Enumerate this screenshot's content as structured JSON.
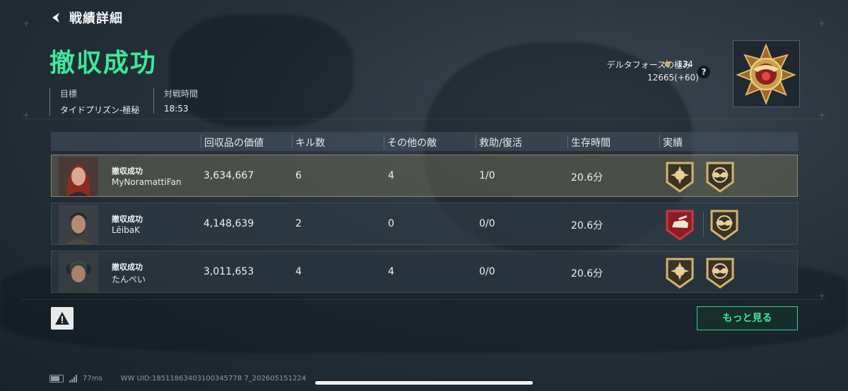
{
  "header": {
    "title": "戦績詳細"
  },
  "result": {
    "title": "撤収成功"
  },
  "info": {
    "target_label": "目標",
    "target_value": "タイドプリズン-極秘",
    "time_label": "対戦時間",
    "time_value": "18:53"
  },
  "rank": {
    "name": "デルタフォースの極み",
    "level": "134",
    "points": "12665(+60)",
    "help": "?"
  },
  "table": {
    "headers": [
      "回収品の価値",
      "キル数",
      "その他の敵",
      "救助/復活",
      "生存時間",
      "実績"
    ],
    "rows": [
      {
        "status": "撤収成功",
        "name": "MyNoramattiFan",
        "value": "3,634,667",
        "kills": "6",
        "other": "4",
        "rescue": "1/0",
        "survival": "20.6分",
        "highlight": true,
        "achievements": [
          "gold-sun-emblem",
          "gold-wings-emblem"
        ]
      },
      {
        "status": "撤収成功",
        "name": "LëibaK",
        "value": "4,148,639",
        "kills": "2",
        "other": "0",
        "rescue": "0/0",
        "survival": "20.6分",
        "highlight": false,
        "achievements": [
          "red-tank-emblem",
          "gold-wings-emblem"
        ]
      },
      {
        "status": "撤収成功",
        "name": "たんぺい",
        "value": "3,011,653",
        "kills": "4",
        "other": "4",
        "rescue": "0/0",
        "survival": "20.6分",
        "highlight": false,
        "achievements": [
          "gold-sun-emblem",
          "gold-wings-emblem"
        ]
      }
    ]
  },
  "buttons": {
    "more": "もっと見る"
  },
  "footer": {
    "ping": "77ms",
    "uid": "WW UID:18511863403100345778 7_202605151224"
  },
  "colors": {
    "accent": "#3ee89a",
    "gold": "#d7b45a",
    "red": "#b0262b"
  }
}
